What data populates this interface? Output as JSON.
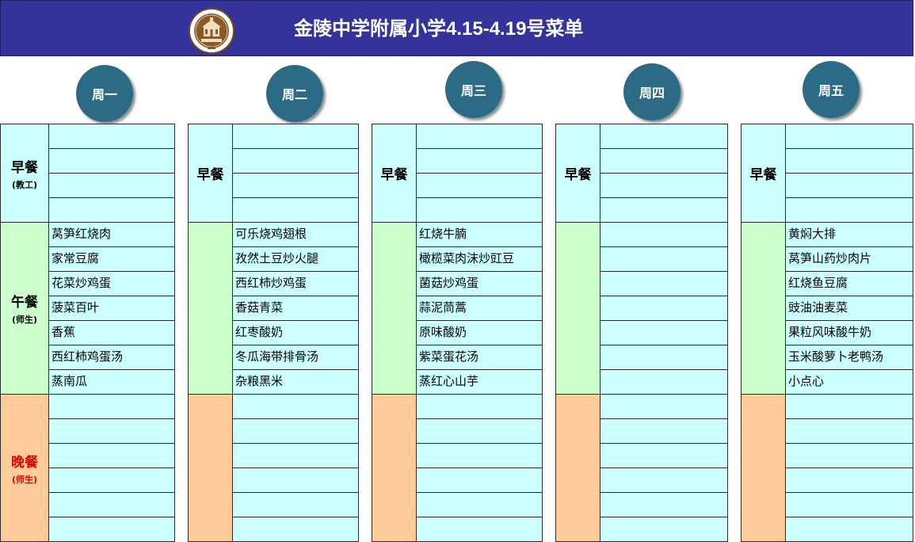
{
  "header": {
    "title": "金陵中学附属小学4.15-4.19号菜单"
  },
  "colors": {
    "header_bg": "#333399",
    "circle": "#2b6b85",
    "cell": "#ccffff",
    "breakfast": "#ccffff",
    "lunch": "#ccffcc",
    "dinner": "#ffcc99",
    "dinner_text": "#e00000"
  },
  "days": [
    {
      "label": "周一",
      "breakfast": {
        "name": "早餐",
        "sub": "(教工)",
        "items": [
          "",
          "",
          "",
          ""
        ]
      },
      "lunch": {
        "name": "午餐",
        "sub": "(师生)",
        "items": [
          "莴笋红烧肉",
          "家常豆腐",
          "花菜炒鸡蛋",
          "菠菜百叶",
          "香蕉",
          "西红柿鸡蛋汤",
          "蒸南瓜"
        ]
      },
      "dinner": {
        "name": "晚餐",
        "sub": "(师生)",
        "items": [
          "",
          "",
          "",
          "",
          "",
          ""
        ]
      }
    },
    {
      "label": "周二",
      "breakfast": {
        "name": "早餐",
        "sub": "",
        "items": [
          "",
          "",
          "",
          ""
        ]
      },
      "lunch": {
        "name": "",
        "sub": "",
        "items": [
          "可乐烧鸡翅根",
          "孜然土豆炒火腿",
          "西红柿炒鸡蛋",
          "香菇青菜",
          "红枣酸奶",
          "冬瓜海带排骨汤",
          "杂粮黑米"
        ]
      },
      "dinner": {
        "name": "",
        "sub": "",
        "items": [
          "",
          "",
          "",
          "",
          "",
          ""
        ]
      }
    },
    {
      "label": "周三",
      "breakfast": {
        "name": "早餐",
        "sub": "",
        "items": [
          "",
          "",
          "",
          ""
        ]
      },
      "lunch": {
        "name": "",
        "sub": "",
        "items": [
          "红烧牛腩",
          "橄榄菜肉沫炒豇豆",
          "菌菇炒鸡蛋",
          "蒜泥茼蒿",
          "原味酸奶",
          "紫菜蛋花汤",
          "蒸红心山芋"
        ]
      },
      "dinner": {
        "name": "",
        "sub": "",
        "items": [
          "",
          "",
          "",
          "",
          "",
          ""
        ]
      }
    },
    {
      "label": "周四",
      "breakfast": {
        "name": "早餐",
        "sub": "",
        "items": [
          "",
          "",
          "",
          ""
        ]
      },
      "lunch": {
        "name": "",
        "sub": "",
        "items": [
          "",
          "",
          "",
          "",
          "",
          "",
          ""
        ]
      },
      "dinner": {
        "name": "",
        "sub": "",
        "items": [
          "",
          "",
          "",
          "",
          "",
          ""
        ]
      }
    },
    {
      "label": "周五",
      "breakfast": {
        "name": "早餐",
        "sub": "",
        "items": [
          "",
          "",
          "",
          ""
        ]
      },
      "lunch": {
        "name": "",
        "sub": "",
        "items": [
          "黄焖大排",
          "莴笋山药炒肉片",
          "红烧鱼豆腐",
          "豉油油麦菜",
          "果粒风味酸牛奶",
          "玉米酸萝卜老鸭汤",
          "小点心"
        ]
      },
      "dinner": {
        "name": "",
        "sub": "",
        "items": [
          "",
          "",
          "",
          "",
          "",
          ""
        ]
      }
    }
  ]
}
